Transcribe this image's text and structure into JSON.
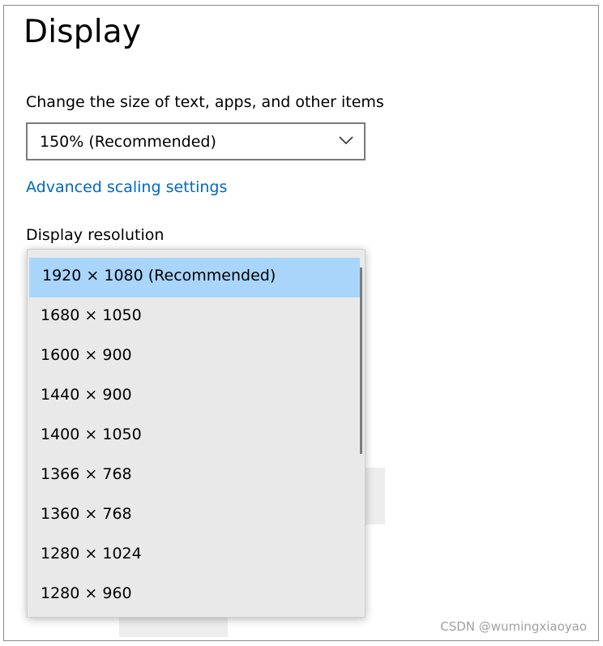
{
  "page": {
    "title": "Display"
  },
  "scale": {
    "label": "Change the size of text, apps, and other items",
    "selected": "150% (Recommended)"
  },
  "advanced_link": "Advanced scaling settings",
  "resolution": {
    "label": "Display resolution",
    "options": [
      "1920 × 1080 (Recommended)",
      "1680 × 1050",
      "1600 × 900",
      "1440 × 900",
      "1400 × 1050",
      "1366 × 768",
      "1360 × 768",
      "1280 × 1024",
      "1280 × 960"
    ]
  },
  "watermark": "CSDN @wumingxiaoyao",
  "colors": {
    "link": "#0067c0",
    "selected_option": "#a9d5fb"
  }
}
